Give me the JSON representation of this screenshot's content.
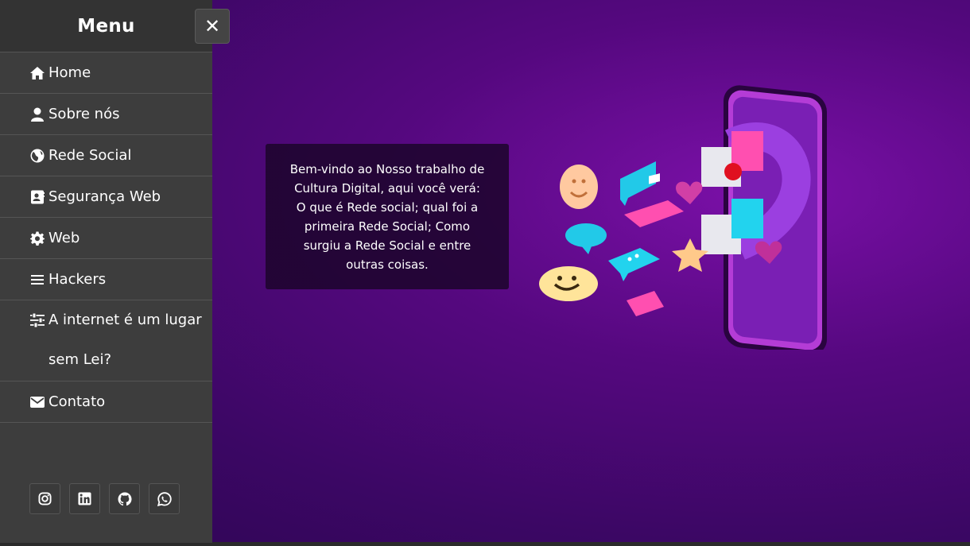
{
  "sidebar": {
    "title": "Menu",
    "items": [
      {
        "label": "Home",
        "icon": "home-icon"
      },
      {
        "label": "Sobre nós",
        "icon": "user-icon"
      },
      {
        "label": "Rede Social",
        "icon": "globe-icon"
      },
      {
        "label": "Segurança Web",
        "icon": "address-card-icon"
      },
      {
        "label": "Web",
        "icon": "gear-icon"
      },
      {
        "label": "Hackers",
        "icon": "bars-icon"
      },
      {
        "label": "A internet é um lugar sem Lei?",
        "icon": "sliders-icon"
      },
      {
        "label": "Contato",
        "icon": "envelope-icon"
      }
    ],
    "socials": [
      "instagram-icon",
      "linkedin-icon",
      "github-icon",
      "whatsapp-icon"
    ]
  },
  "close_button": {
    "label": "✕"
  },
  "intro": {
    "line1": "Bem-vindo ao Nosso trabalho de",
    "line2": "Cultura Digital, aqui você verá:",
    "line3": "O que é Rede social; qual foi a",
    "line4": "primeira Rede Social; Como",
    "line5": "surgiu a Rede Social e entre",
    "line6": "outras coisas."
  },
  "colors": {
    "sidebar_bg": "#3d3d3d",
    "hero_bg": "#4a0a70",
    "accent_pink": "#ff3fa4",
    "accent_cyan": "#21d4f0"
  }
}
